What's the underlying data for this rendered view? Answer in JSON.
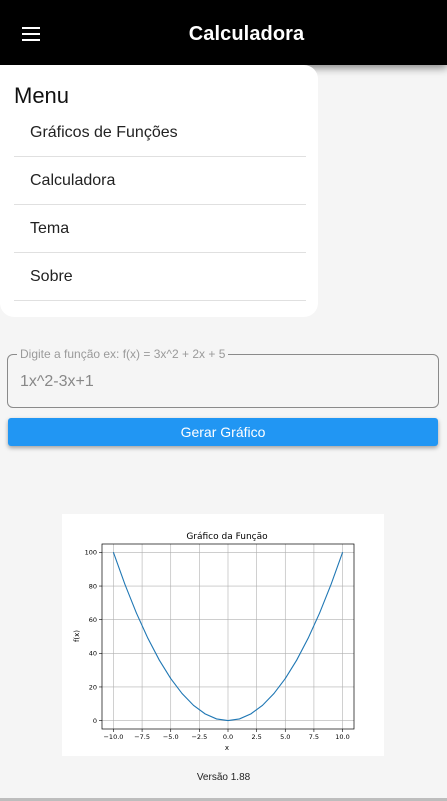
{
  "appbar": {
    "title": "Calculadora",
    "menu_icon": "hamburger-menu-icon"
  },
  "menu": {
    "heading": "Menu",
    "items": [
      {
        "label": "Gráficos de Funções"
      },
      {
        "label": "Calculadora"
      },
      {
        "label": "Tema"
      },
      {
        "label": "Sobre"
      }
    ]
  },
  "function_input": {
    "label": "Digite a função ex: f(x) = 3x^2 + 2x + 5",
    "value": "1x^2-3x+1"
  },
  "generate_button": {
    "label": "Gerar Gráfico"
  },
  "chart_data": {
    "type": "line",
    "title": "Gráfico da Função",
    "xlabel": "x",
    "ylabel": "f(x)",
    "xlim": [
      -11,
      11
    ],
    "ylim": [
      -5,
      105
    ],
    "grid": true,
    "x_ticks": [
      -10.0,
      -7.5,
      -5.0,
      -2.5,
      0.0,
      2.5,
      5.0,
      7.5,
      10.0
    ],
    "x_tick_labels": [
      "−10.0",
      "−7.5",
      "−5.0",
      "−2.5",
      "0.0",
      "2.5",
      "5.0",
      "7.5",
      "10.0"
    ],
    "y_ticks": [
      0,
      20,
      40,
      60,
      80,
      100
    ],
    "y_tick_labels": [
      "0",
      "20",
      "40",
      "60",
      "80",
      "100"
    ],
    "series": [
      {
        "color": "#1f77b4",
        "x": [
          -10,
          -9,
          -8,
          -7,
          -6,
          -5,
          -4,
          -3,
          -2,
          -1,
          0,
          1,
          2,
          3,
          4,
          5,
          6,
          7,
          8,
          9,
          10
        ],
        "y": [
          100,
          81,
          64,
          49,
          36,
          25,
          16,
          9,
          4,
          1,
          0,
          1,
          4,
          9,
          16,
          25,
          36,
          49,
          64,
          81,
          100
        ]
      }
    ]
  },
  "footer": {
    "version": "Versão 1.88"
  }
}
